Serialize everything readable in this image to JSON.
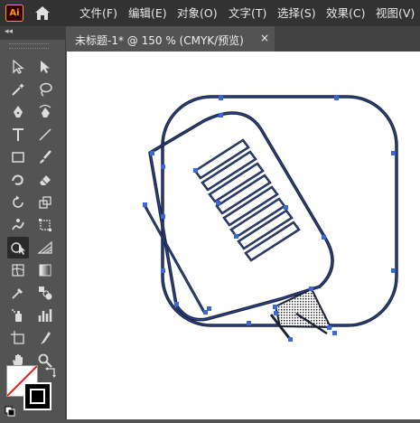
{
  "app": {
    "logo_text": "Ai"
  },
  "menu": [
    "文件(F)",
    "编辑(E)",
    "对象(O)",
    "文字(T)",
    "选择(S)",
    "效果(C)",
    "视图(V)"
  ],
  "document_tab": {
    "title": "未标题-1* @ 150 % (CMYK/预览)",
    "close": "×"
  },
  "toolpanel": {
    "collapse": "◂◂"
  },
  "colors": {
    "accent": "#ff9a00",
    "path_fill": "#1a2233",
    "path_stroke": "#2d4fb8",
    "anchor": "#3a67d9"
  }
}
